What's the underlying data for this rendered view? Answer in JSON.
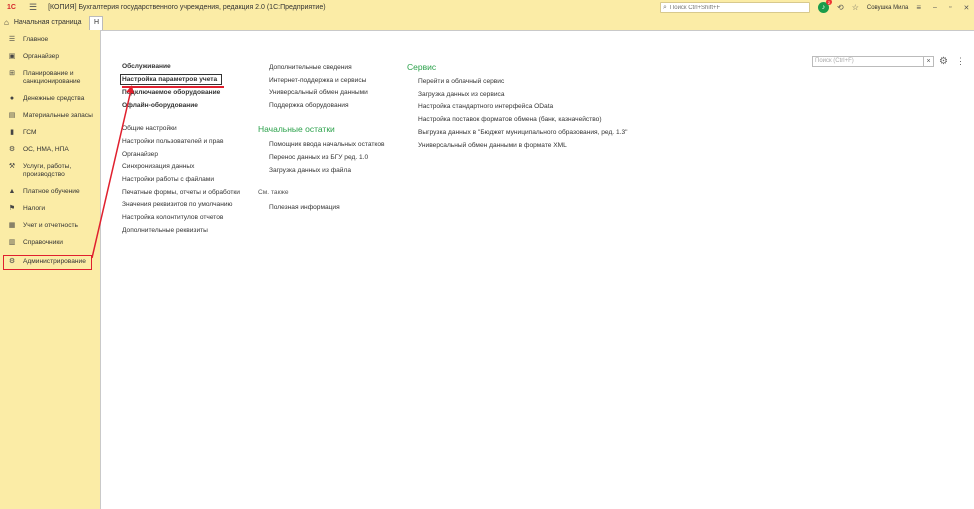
{
  "titlebar": {
    "logo": "1С",
    "title": "[КОПИЯ] Бухгалтерия государственного учреждения, редакция 2.0  (1С:Предприятие)",
    "search_placeholder": "Поиск Ctrl+Shift+F",
    "notification_count": "2",
    "user": "Совушка Мила"
  },
  "tabs": {
    "home": "Начальная страница",
    "active": "Н"
  },
  "sidebar": {
    "items": [
      {
        "label": "Главное",
        "icon": "menu-icon"
      },
      {
        "label": "Органайзер",
        "icon": "organizer-icon"
      },
      {
        "label": "Планирование и санкционирование",
        "icon": "planning-icon"
      },
      {
        "label": "Денежные средства",
        "icon": "money-icon"
      },
      {
        "label": "Материальные запасы",
        "icon": "inventory-icon"
      },
      {
        "label": "ГСМ",
        "icon": "fuel-icon"
      },
      {
        "label": "ОС, НМА, НПА",
        "icon": "assets-icon"
      },
      {
        "label": "Услуги, работы, производство",
        "icon": "services-icon"
      },
      {
        "label": "Платное обучение",
        "icon": "education-icon"
      },
      {
        "label": "Налоги",
        "icon": "taxes-icon"
      },
      {
        "label": "Учет и отчетность",
        "icon": "reports-icon"
      },
      {
        "label": "Справочники",
        "icon": "reference-icon"
      },
      {
        "label": "Администрирование",
        "icon": "gear-icon"
      }
    ]
  },
  "main": {
    "search_placeholder": "Поиск (Ctrl+F)",
    "col1": {
      "bold_links": [
        "Обслуживание",
        "Настройка параметров учета",
        "Подключаемое оборудование",
        "Офлайн-оборудование"
      ],
      "links": [
        "Общие настройки",
        "Настройки пользователей и прав",
        "Органайзер",
        "Синхронизация данных",
        "Настройки работы с файлами",
        "Печатные формы, отчеты и обработки",
        "Значения реквизитов по умолчанию",
        "Настройка колонтитулов отчетов",
        "Дополнительные реквизиты"
      ]
    },
    "col2": {
      "links_top": [
        "Дополнительные сведения",
        "Интернет-поддержка и сервисы",
        "Универсальный обмен данными",
        "Поддержка оборудования"
      ],
      "section_title": "Начальные остатки",
      "links_mid": [
        "Помощник ввода начальных остатков",
        "Перенос данных из БГУ ред. 1.0",
        "Загрузка данных из файла"
      ],
      "see_also": "См. также",
      "links_bottom": [
        "Полезная информация"
      ]
    },
    "col3": {
      "section_title": "Сервис",
      "links": [
        "Перейти в облачный сервис",
        "Загрузка данных из сервиса",
        "Настройка стандартного интерфейса OData",
        "Настройка поставок форматов обмена (банк, казначейство)",
        "Выгрузка данных в \"Бюджет муниципального образования, ред. 1.3\"",
        "Универсальный обмен данными в формате XML"
      ]
    }
  },
  "colors": {
    "accent_green": "#2aa14a",
    "highlight_red": "#e0202e",
    "sidebar_bg": "#fbeca6"
  }
}
